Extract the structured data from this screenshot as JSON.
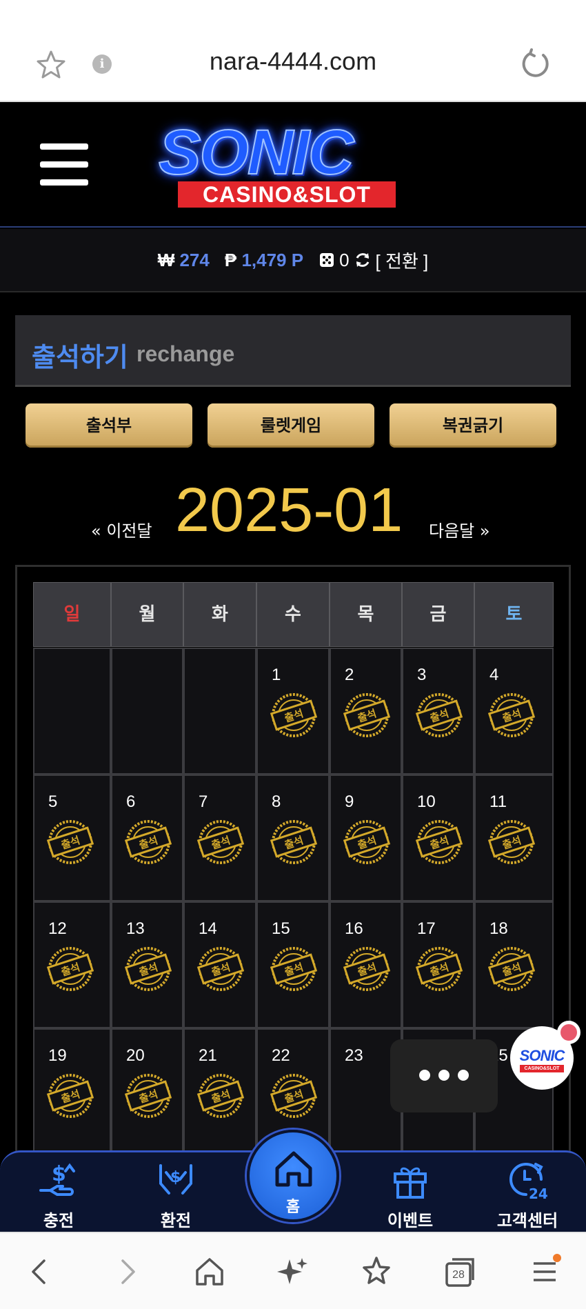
{
  "browser": {
    "url": "nara-4444.com",
    "tab_count": "28"
  },
  "header": {
    "logo_main": "SONIC",
    "logo_sub": "CASINO&SLOT"
  },
  "balance": {
    "won_symbol": "₩",
    "won_value": "274",
    "point_symbol": "₱",
    "point_value": "1,479 P",
    "dice_value": "0",
    "convert_label": "[ 전환 ]"
  },
  "section": {
    "title_ko": "출석하기",
    "title_en": "rechange"
  },
  "actions": [
    {
      "label": "출석부"
    },
    {
      "label": "룰렛게임"
    },
    {
      "label": "복권긁기"
    }
  ],
  "month_nav": {
    "prev_label": "« 이전달",
    "current": "2025-01",
    "next_label": "다음달 »"
  },
  "calendar": {
    "weekdays": [
      "일",
      "월",
      "화",
      "수",
      "목",
      "금",
      "토"
    ],
    "stamp_text": "출석",
    "weeks": [
      [
        null,
        null,
        null,
        {
          "day": "1",
          "attended": true
        },
        {
          "day": "2",
          "attended": true
        },
        {
          "day": "3",
          "attended": true
        },
        {
          "day": "4",
          "attended": true
        }
      ],
      [
        {
          "day": "5",
          "attended": true
        },
        {
          "day": "6",
          "attended": true
        },
        {
          "day": "7",
          "attended": true
        },
        {
          "day": "8",
          "attended": true
        },
        {
          "day": "9",
          "attended": true
        },
        {
          "day": "10",
          "attended": true
        },
        {
          "day": "11",
          "attended": true
        }
      ],
      [
        {
          "day": "12",
          "attended": true
        },
        {
          "day": "13",
          "attended": true
        },
        {
          "day": "14",
          "attended": true
        },
        {
          "day": "15",
          "attended": true
        },
        {
          "day": "16",
          "attended": true
        },
        {
          "day": "17",
          "attended": true
        },
        {
          "day": "18",
          "attended": true
        }
      ],
      [
        {
          "day": "19",
          "attended": true
        },
        {
          "day": "20",
          "attended": true
        },
        {
          "day": "21",
          "attended": true
        },
        {
          "day": "22",
          "attended": true
        },
        {
          "day": "23",
          "attended": false
        },
        {
          "day": "",
          "attended": false
        },
        {
          "day": "25",
          "attended": false
        }
      ]
    ]
  },
  "floating": {
    "logo_main": "SONIC",
    "logo_sub": "CASINO&SLOT"
  },
  "bottom_nav": {
    "items": [
      {
        "label": "충전",
        "icon": "deposit-icon"
      },
      {
        "label": "환전",
        "icon": "withdraw-icon"
      },
      {
        "label": "홈",
        "icon": "home-icon"
      },
      {
        "label": "이벤트",
        "icon": "gift-icon"
      },
      {
        "label": "고객센터",
        "icon": "support-24-icon"
      }
    ]
  },
  "colors": {
    "accent_blue": "#4e8bf0",
    "gold": "#f2c94c",
    "sunday_red": "#e03a3a",
    "saturday_blue": "#6fb4f0"
  }
}
